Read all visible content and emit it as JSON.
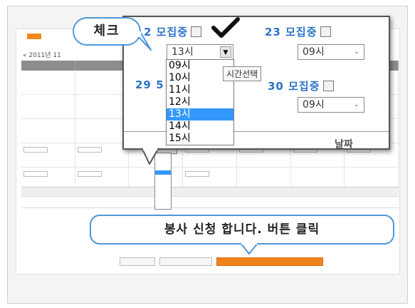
{
  "popup": {
    "slot_22_label": "2 모집중",
    "slot_23_label": "23 모집중",
    "slot_29_label": "29 5",
    "slot_30_label": "30 모집중",
    "select_22_value": "13시",
    "select_23_value": "09시",
    "select_30_value": "09시",
    "tooltip": "시간선택",
    "partial_text": "날짜",
    "dropdown_options": [
      "09시",
      "10시",
      "11시",
      "12시",
      "13시",
      "14시",
      "15시"
    ],
    "dropdown_selected": "13시"
  },
  "callouts": {
    "check": "체크",
    "apply": "봉사 신청 합니다. 버튼 클릭"
  },
  "background": {
    "year_nav": "« 2011년 11"
  },
  "colors": {
    "accent_blue": "#2d72c6",
    "bubble_border": "#4f97d6",
    "selected_option": "#3399ff",
    "apply_button": "#f0841b"
  }
}
